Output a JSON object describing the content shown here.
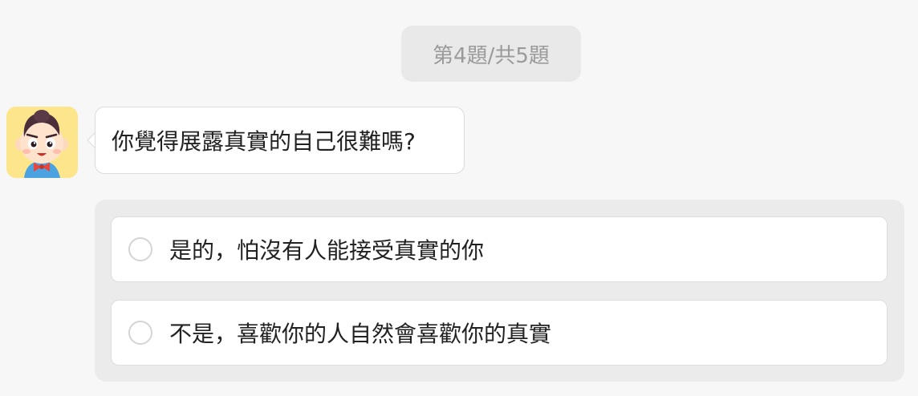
{
  "progress": {
    "label": "第4題/共5題"
  },
  "question": {
    "avatar_icon": "cartoon-boy-avatar-icon",
    "text": "你覺得展露真實的自己很難嗎?"
  },
  "options": [
    {
      "label": "是的，怕沒有人能接受真實的你",
      "selected": false
    },
    {
      "label": "不是，喜歡你的人自然會喜歡你的真實",
      "selected": false
    }
  ],
  "colors": {
    "page_background": "#f7f7f7",
    "pill_background": "#e9e9e9",
    "pill_text": "#9a9a9a",
    "avatar_background": "#fce58a",
    "panel_background": "#ebebeb",
    "card_background": "#ffffff",
    "text": "#222222"
  }
}
